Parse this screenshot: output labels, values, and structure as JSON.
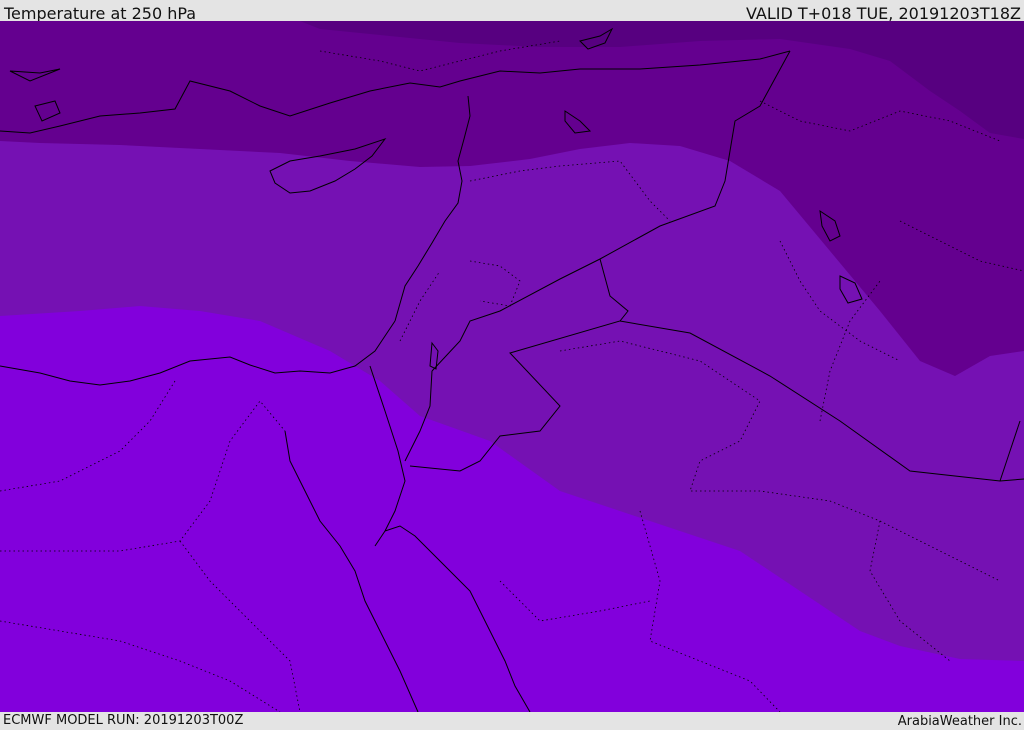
{
  "header": {
    "title": "Temperature at 250 hPa",
    "valid": "VALID T+018 TUE, 20191203T18Z"
  },
  "footer": {
    "model_run": "ECMWF MODEL RUN: 20191203T00Z",
    "brand": "ArabiaWeather Inc."
  },
  "map": {
    "fill_colors": {
      "coldest": "#570080",
      "cold": "#64008f",
      "mid": "#7511b3",
      "warm": "#8200dc"
    },
    "line_color": "#000000"
  }
}
